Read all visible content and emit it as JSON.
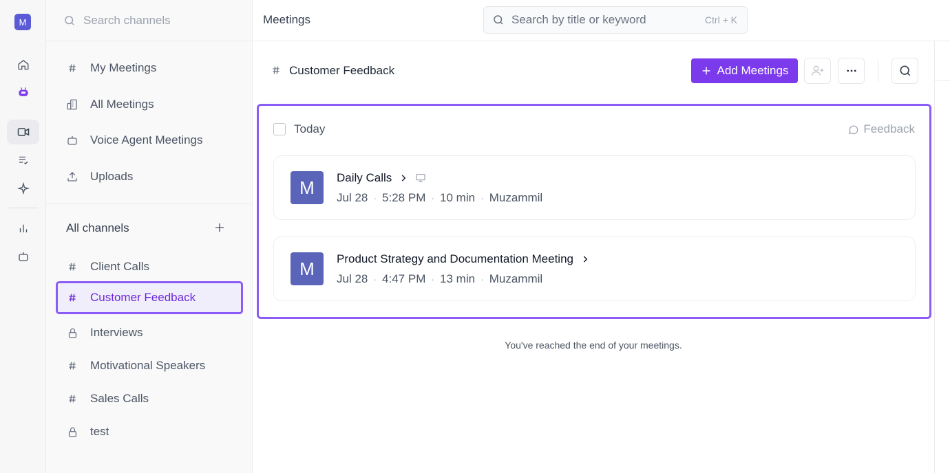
{
  "rail": {
    "avatar_letter": "M"
  },
  "sidebar": {
    "search_placeholder": "Search channels",
    "nav": [
      {
        "label": "My Meetings"
      },
      {
        "label": "All Meetings"
      },
      {
        "label": "Voice Agent Meetings"
      },
      {
        "label": "Uploads"
      }
    ],
    "channels_title": "All channels",
    "channels": [
      {
        "label": "Client Calls",
        "icon": "hash-icon"
      },
      {
        "label": "Customer Feedback",
        "icon": "hash-icon",
        "selected": true
      },
      {
        "label": "Interviews",
        "icon": "lock-icon"
      },
      {
        "label": "Motivational Speakers",
        "icon": "hash-icon"
      },
      {
        "label": "Sales Calls",
        "icon": "hash-icon"
      },
      {
        "label": "test",
        "icon": "lock-icon"
      }
    ]
  },
  "topbar": {
    "title": "Meetings",
    "search_placeholder": "Search by title or keyword",
    "shortcut": "Ctrl + K"
  },
  "channel_header": {
    "name": "Customer Feedback",
    "add_label": "Add Meetings"
  },
  "group": {
    "label": "Today",
    "feedback_label": "Feedback",
    "meetings": [
      {
        "avatar": "M",
        "title": "Daily Calls",
        "date": "Jul 28",
        "time": "5:28 PM",
        "duration": "10 min",
        "owner": "Muzammil",
        "has_screen_icon": true
      },
      {
        "avatar": "M",
        "title": "Product Strategy and Documentation Meeting",
        "date": "Jul 28",
        "time": "4:47 PM",
        "duration": "13 min",
        "owner": "Muzammil",
        "has_screen_icon": false
      }
    ]
  },
  "end_note": "You've reached the end of your meetings.",
  "colors": {
    "accent": "#7c3aed",
    "avatar": "#5a64b8",
    "highlight_border": "#8b5cf6"
  }
}
